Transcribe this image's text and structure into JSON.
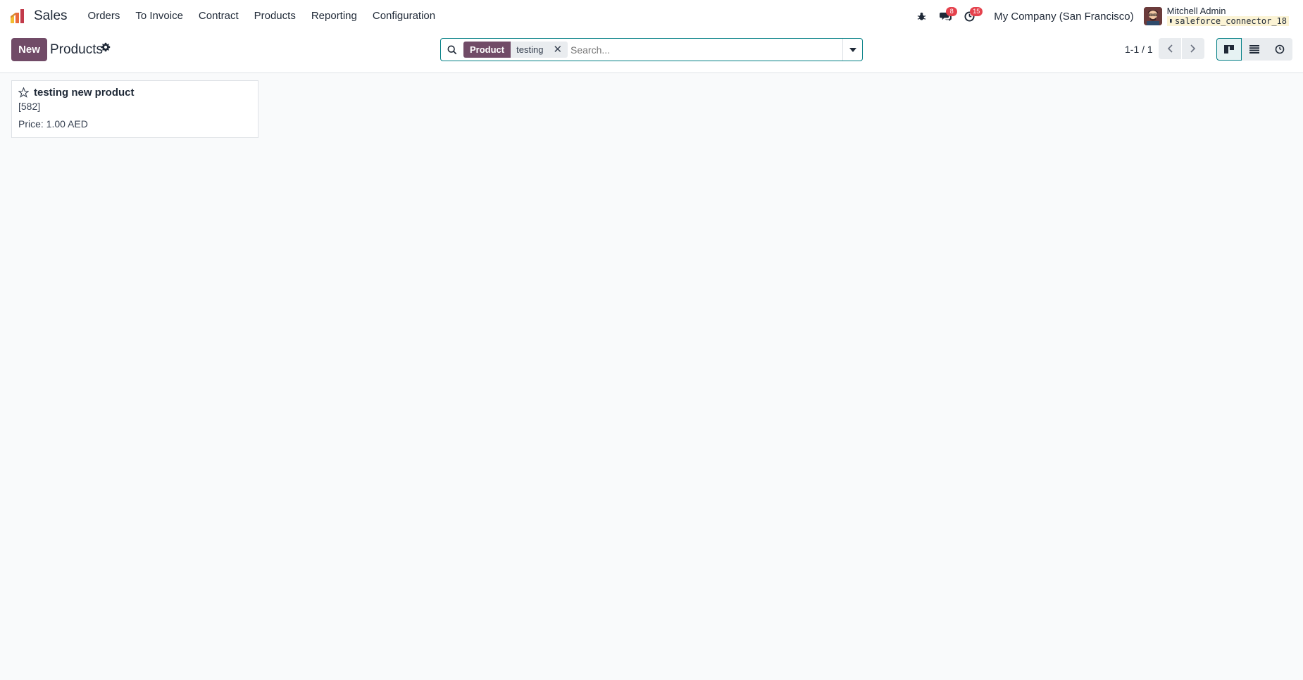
{
  "navbar": {
    "app_name": "Sales",
    "menu": [
      "Orders",
      "To Invoice",
      "Contract",
      "Products",
      "Reporting",
      "Configuration"
    ],
    "messages_count": "8",
    "activities_count": "15",
    "company": "My Company (San Francisco)",
    "user_name": "Mitchell Admin",
    "database": "saleforce_connector_18"
  },
  "control_panel": {
    "new_label": "New",
    "title": "Products",
    "search": {
      "facet_label": "Product",
      "facet_value": "testing",
      "placeholder": "Search..."
    },
    "pager": "1-1 / 1"
  },
  "records": [
    {
      "name": "testing new product",
      "code": "[582]",
      "price": "Price: 1.00 AED"
    }
  ],
  "colors": {
    "brand": "#714b67",
    "accent": "#017e84",
    "badge": "#e5424d"
  }
}
